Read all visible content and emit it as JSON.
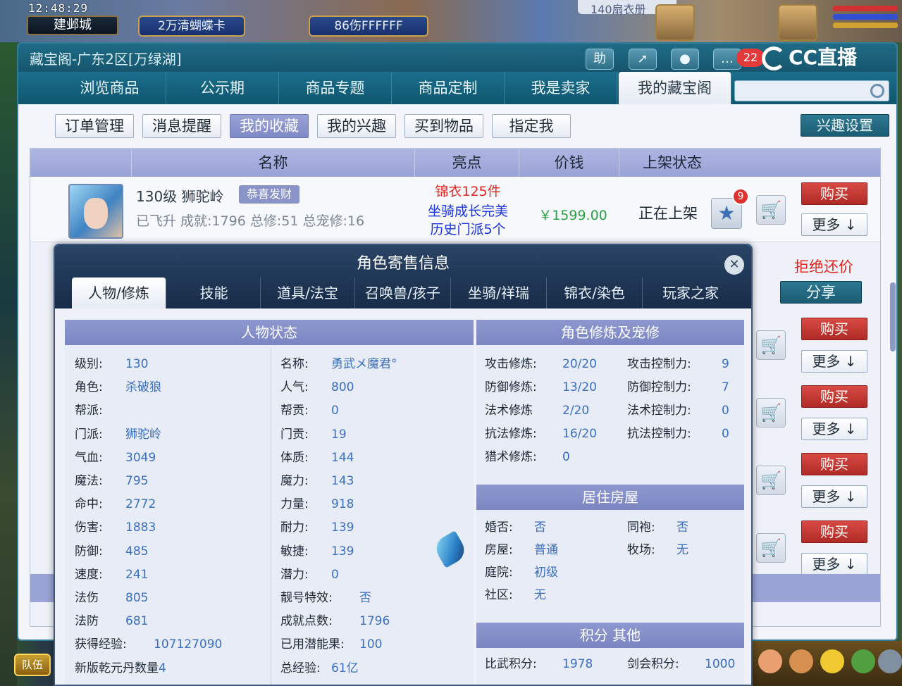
{
  "game": {
    "clock": "12:48:29",
    "city": "建邺城",
    "btn1": "2万清蝴蝶卡",
    "btn2": "86伤FFFFFF",
    "top_badge": "140扇衣册",
    "team": "队伍"
  },
  "window": {
    "title": "藏宝阁-广东2区[万绿湖]",
    "help": "助",
    "notif_count": "22",
    "cc_label": "CC直播"
  },
  "nav": {
    "tabs": [
      "浏览商品",
      "公示期",
      "商品专题",
      "商品定制",
      "我是卖家",
      "我的藏宝阁"
    ],
    "active": "我的藏宝阁"
  },
  "subtabs": {
    "items": [
      "订单管理",
      "消息提醒",
      "我的收藏",
      "我的兴趣",
      "买到物品",
      "指定我"
    ],
    "active": "我的收藏",
    "interest_settings": "兴趣设置"
  },
  "list": {
    "columns": [
      "名称",
      "亮点",
      "价钱",
      "上架状态"
    ],
    "item": {
      "name": "130级  狮驼岭",
      "tag": "恭喜发财",
      "sub": "已飞升  成就:1796  总修:51  总宠修:16",
      "highlights": [
        "锦衣125件",
        "坐骑成长完美",
        "历史门派5个"
      ],
      "price": "￥1599.00",
      "status": "正在上架",
      "fav_badge": "9"
    },
    "buy": "购买",
    "more": "更多 ↓",
    "refuse": "拒绝还价",
    "share": "分享"
  },
  "modal": {
    "title": "角色寄售信息",
    "tabs": [
      "人物/修炼",
      "技能",
      "道具/法宝",
      "召唤兽/孩子",
      "坐骑/祥瑞",
      "锦衣/染色",
      "玩家之家"
    ],
    "active": "人物/修炼",
    "status_title": "人物状态",
    "status_left": [
      {
        "k": "级别:",
        "v": "130"
      },
      {
        "k": "角色:",
        "v": "杀破狼"
      },
      {
        "k": "帮派:",
        "v": ""
      },
      {
        "k": "门派:",
        "v": "狮驼岭"
      },
      {
        "k": "气血:",
        "v": "3049"
      },
      {
        "k": "魔法:",
        "v": "795"
      },
      {
        "k": "命中:",
        "v": "2772"
      },
      {
        "k": "伤害:",
        "v": "1883"
      },
      {
        "k": "防御:",
        "v": "485"
      },
      {
        "k": "速度:",
        "v": "241"
      },
      {
        "k": "法伤",
        "v": "805"
      },
      {
        "k": "法防",
        "v": "681"
      },
      {
        "k": "获得经验:",
        "v": "107127090"
      },
      {
        "k": "新版乾元丹数量",
        "v": "4"
      }
    ],
    "status_right": [
      {
        "k": "名称:",
        "v": "勇武メ魔君°"
      },
      {
        "k": "人气:",
        "v": "800"
      },
      {
        "k": "帮贡:",
        "v": "0"
      },
      {
        "k": "门贡:",
        "v": "19"
      },
      {
        "k": "体质:",
        "v": "144"
      },
      {
        "k": "魔力:",
        "v": "143"
      },
      {
        "k": "力量:",
        "v": "918"
      },
      {
        "k": "耐力:",
        "v": "139"
      },
      {
        "k": "敏捷:",
        "v": "139"
      },
      {
        "k": "潜力:",
        "v": "0"
      },
      {
        "k": "靓号特效:",
        "v": "否"
      },
      {
        "k": "成就点数:",
        "v": "1796"
      },
      {
        "k": "已用潜能果:",
        "v": "100"
      },
      {
        "k": "总经验:",
        "v": "61亿"
      }
    ],
    "cult_title": "角色修炼及宠修",
    "cult_left": [
      {
        "k": "攻击修炼:",
        "v": "20/20"
      },
      {
        "k": "防御修炼:",
        "v": "13/20"
      },
      {
        "k": "法术修炼",
        "v": "2/20"
      },
      {
        "k": "抗法修炼:",
        "v": "16/20"
      },
      {
        "k": "猎术修炼:",
        "v": "0"
      }
    ],
    "cult_right": [
      {
        "k": "攻击控制力:",
        "v": "9"
      },
      {
        "k": "防御控制力:",
        "v": "7"
      },
      {
        "k": "法术控制力:",
        "v": "0"
      },
      {
        "k": "抗法控制力:",
        "v": "0"
      }
    ],
    "house_title": "居住房屋",
    "house_left": [
      {
        "k": "婚否:",
        "v": "否"
      },
      {
        "k": "房屋:",
        "v": "普通"
      },
      {
        "k": "庭院:",
        "v": "初级"
      },
      {
        "k": "社区:",
        "v": "无"
      }
    ],
    "house_right": [
      {
        "k": "同袍:",
        "v": "否"
      },
      {
        "k": "牧场:",
        "v": "无"
      }
    ],
    "score_title": "积分 其他",
    "scores": [
      {
        "k": "比武积分:",
        "v": "1978"
      },
      {
        "k": "剑会积分:",
        "v": "1000"
      }
    ]
  }
}
